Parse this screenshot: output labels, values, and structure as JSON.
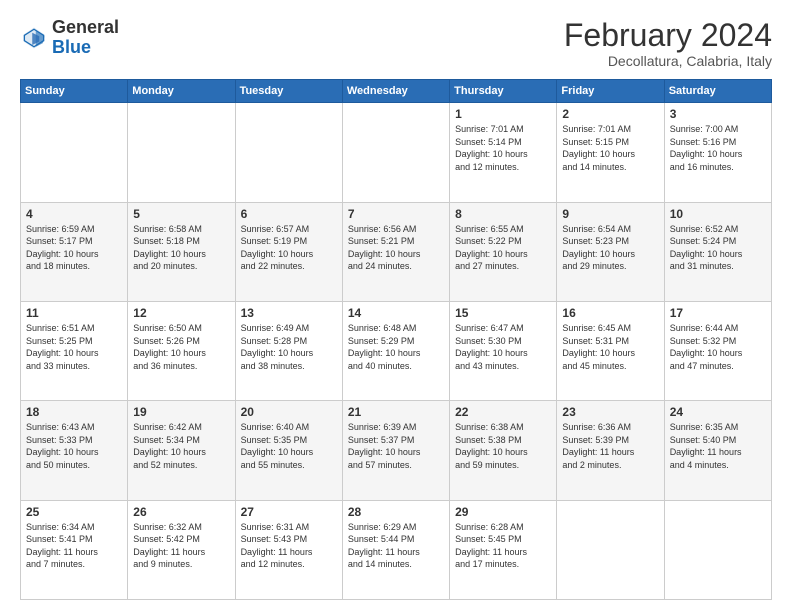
{
  "header": {
    "logo": {
      "line1": "General",
      "line2": "Blue"
    },
    "title": "February 2024",
    "subtitle": "Decollatura, Calabria, Italy"
  },
  "columns": [
    "Sunday",
    "Monday",
    "Tuesday",
    "Wednesday",
    "Thursday",
    "Friday",
    "Saturday"
  ],
  "weeks": [
    [
      {
        "day": "",
        "info": ""
      },
      {
        "day": "",
        "info": ""
      },
      {
        "day": "",
        "info": ""
      },
      {
        "day": "",
        "info": ""
      },
      {
        "day": "1",
        "info": "Sunrise: 7:01 AM\nSunset: 5:14 PM\nDaylight: 10 hours\nand 12 minutes."
      },
      {
        "day": "2",
        "info": "Sunrise: 7:01 AM\nSunset: 5:15 PM\nDaylight: 10 hours\nand 14 minutes."
      },
      {
        "day": "3",
        "info": "Sunrise: 7:00 AM\nSunset: 5:16 PM\nDaylight: 10 hours\nand 16 minutes."
      }
    ],
    [
      {
        "day": "4",
        "info": "Sunrise: 6:59 AM\nSunset: 5:17 PM\nDaylight: 10 hours\nand 18 minutes."
      },
      {
        "day": "5",
        "info": "Sunrise: 6:58 AM\nSunset: 5:18 PM\nDaylight: 10 hours\nand 20 minutes."
      },
      {
        "day": "6",
        "info": "Sunrise: 6:57 AM\nSunset: 5:19 PM\nDaylight: 10 hours\nand 22 minutes."
      },
      {
        "day": "7",
        "info": "Sunrise: 6:56 AM\nSunset: 5:21 PM\nDaylight: 10 hours\nand 24 minutes."
      },
      {
        "day": "8",
        "info": "Sunrise: 6:55 AM\nSunset: 5:22 PM\nDaylight: 10 hours\nand 27 minutes."
      },
      {
        "day": "9",
        "info": "Sunrise: 6:54 AM\nSunset: 5:23 PM\nDaylight: 10 hours\nand 29 minutes."
      },
      {
        "day": "10",
        "info": "Sunrise: 6:52 AM\nSunset: 5:24 PM\nDaylight: 10 hours\nand 31 minutes."
      }
    ],
    [
      {
        "day": "11",
        "info": "Sunrise: 6:51 AM\nSunset: 5:25 PM\nDaylight: 10 hours\nand 33 minutes."
      },
      {
        "day": "12",
        "info": "Sunrise: 6:50 AM\nSunset: 5:26 PM\nDaylight: 10 hours\nand 36 minutes."
      },
      {
        "day": "13",
        "info": "Sunrise: 6:49 AM\nSunset: 5:28 PM\nDaylight: 10 hours\nand 38 minutes."
      },
      {
        "day": "14",
        "info": "Sunrise: 6:48 AM\nSunset: 5:29 PM\nDaylight: 10 hours\nand 40 minutes."
      },
      {
        "day": "15",
        "info": "Sunrise: 6:47 AM\nSunset: 5:30 PM\nDaylight: 10 hours\nand 43 minutes."
      },
      {
        "day": "16",
        "info": "Sunrise: 6:45 AM\nSunset: 5:31 PM\nDaylight: 10 hours\nand 45 minutes."
      },
      {
        "day": "17",
        "info": "Sunrise: 6:44 AM\nSunset: 5:32 PM\nDaylight: 10 hours\nand 47 minutes."
      }
    ],
    [
      {
        "day": "18",
        "info": "Sunrise: 6:43 AM\nSunset: 5:33 PM\nDaylight: 10 hours\nand 50 minutes."
      },
      {
        "day": "19",
        "info": "Sunrise: 6:42 AM\nSunset: 5:34 PM\nDaylight: 10 hours\nand 52 minutes."
      },
      {
        "day": "20",
        "info": "Sunrise: 6:40 AM\nSunset: 5:35 PM\nDaylight: 10 hours\nand 55 minutes."
      },
      {
        "day": "21",
        "info": "Sunrise: 6:39 AM\nSunset: 5:37 PM\nDaylight: 10 hours\nand 57 minutes."
      },
      {
        "day": "22",
        "info": "Sunrise: 6:38 AM\nSunset: 5:38 PM\nDaylight: 10 hours\nand 59 minutes."
      },
      {
        "day": "23",
        "info": "Sunrise: 6:36 AM\nSunset: 5:39 PM\nDaylight: 11 hours\nand 2 minutes."
      },
      {
        "day": "24",
        "info": "Sunrise: 6:35 AM\nSunset: 5:40 PM\nDaylight: 11 hours\nand 4 minutes."
      }
    ],
    [
      {
        "day": "25",
        "info": "Sunrise: 6:34 AM\nSunset: 5:41 PM\nDaylight: 11 hours\nand 7 minutes."
      },
      {
        "day": "26",
        "info": "Sunrise: 6:32 AM\nSunset: 5:42 PM\nDaylight: 11 hours\nand 9 minutes."
      },
      {
        "day": "27",
        "info": "Sunrise: 6:31 AM\nSunset: 5:43 PM\nDaylight: 11 hours\nand 12 minutes."
      },
      {
        "day": "28",
        "info": "Sunrise: 6:29 AM\nSunset: 5:44 PM\nDaylight: 11 hours\nand 14 minutes."
      },
      {
        "day": "29",
        "info": "Sunrise: 6:28 AM\nSunset: 5:45 PM\nDaylight: 11 hours\nand 17 minutes."
      },
      {
        "day": "",
        "info": ""
      },
      {
        "day": "",
        "info": ""
      }
    ]
  ]
}
